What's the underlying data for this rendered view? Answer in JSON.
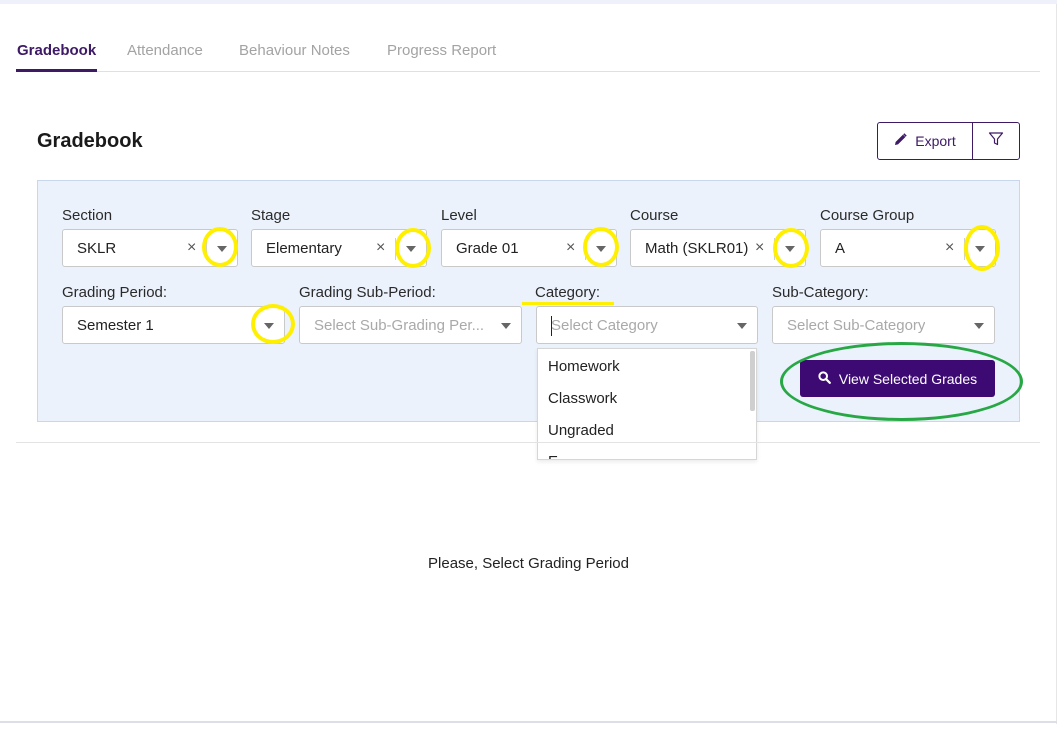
{
  "tabs": [
    {
      "label": "Gradebook",
      "active": true
    },
    {
      "label": "Attendance",
      "active": false
    },
    {
      "label": "Behaviour Notes",
      "active": false
    },
    {
      "label": "Progress Report",
      "active": false
    }
  ],
  "page_title": "Gradebook",
  "toolbar": {
    "export_label": "Export",
    "export_icon": "pencil-icon",
    "filter_icon": "funnel-icon"
  },
  "filters": {
    "section": {
      "label": "Section",
      "value": "SKLR",
      "clear": "×"
    },
    "stage": {
      "label": "Stage",
      "value": "Elementary",
      "clear": "×"
    },
    "level": {
      "label": "Level",
      "value": "Grade 01",
      "clear": "×"
    },
    "course": {
      "label": "Course",
      "value": "Math (SKLR01)",
      "clear": "×"
    },
    "course_group": {
      "label": "Course Group",
      "value": "A",
      "clear": "×"
    },
    "grading_period": {
      "label": "Grading Period:",
      "value": "Semester 1"
    },
    "grading_sub_period": {
      "label": "Grading Sub-Period:",
      "placeholder": "Select Sub-Grading Per..."
    },
    "category": {
      "label": "Category:",
      "placeholder": "Select Category"
    },
    "sub_category": {
      "label": "Sub-Category:",
      "placeholder": "Select Sub-Category"
    }
  },
  "category_dropdown": {
    "options": [
      "Homework",
      "Classwork",
      "Ungraded",
      "E"
    ]
  },
  "view_button": {
    "label": "View Selected Grades",
    "icon": "search-icon"
  },
  "empty_message": "Please, Select Grading Period",
  "colors": {
    "brand": "#3d1966",
    "primary_button": "#3d0a73",
    "panel_bg": "#ebf2fc",
    "annotation_yellow": "#ffef00",
    "annotation_green": "#27a845"
  }
}
